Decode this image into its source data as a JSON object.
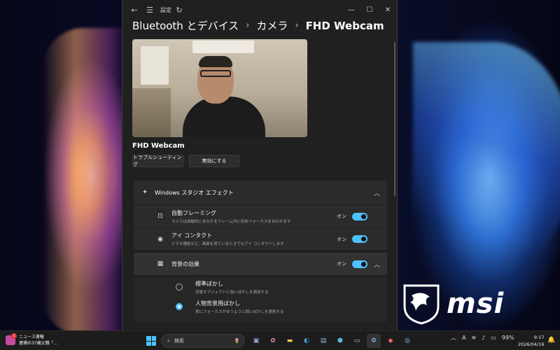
{
  "window": {
    "title": "設定",
    "breadcrumb": [
      "Bluetooth とデバイス",
      "カメラ",
      "FHD Webcam"
    ],
    "bc_separator": "›",
    "device_name": "FHD Webcam",
    "buttons": {
      "troubleshoot": "トラブルシューティング",
      "disable": "無効にする"
    },
    "studio_effects": {
      "header": "Windows スタジオ エフェクト",
      "items": [
        {
          "title": "自動フレーミング",
          "desc": "カメラは自動的にあなたをフレーム内に収めフォーカスを合わせます",
          "state": "オン",
          "on": true,
          "icon": "framing-icon"
        },
        {
          "title": "アイ コンタクト",
          "desc": "ビデオ通話など、画面を見ているときでもアイ コンタクトします",
          "state": "オン",
          "on": true,
          "icon": "eye-contact-icon"
        }
      ],
      "background": {
        "title": "背景の効果",
        "state": "オン",
        "on": true,
        "options": [
          {
            "title": "標準ぼかし",
            "desc": "背景オブジェクトに強いぼかしを適用する",
            "selected": false
          },
          {
            "title": "人物背景用ぼかし",
            "desc": "常にフォーカスが合うように弱いぼかしを適用する",
            "selected": true
          }
        ]
      }
    }
  },
  "taskbar": {
    "news_title": "ニュース速報",
    "news_sub": "逮捕の37歳父親「...",
    "news_badge": "1",
    "search_placeholder": "検索",
    "battery": "99%",
    "ime": "A",
    "time": "9:17",
    "date": "2026/04/16"
  },
  "desktop": {
    "brand": "msi"
  },
  "colors": {
    "accent": "#4cc2ff",
    "window_bg": "#202020",
    "card_bg": "#2b2b2b"
  }
}
